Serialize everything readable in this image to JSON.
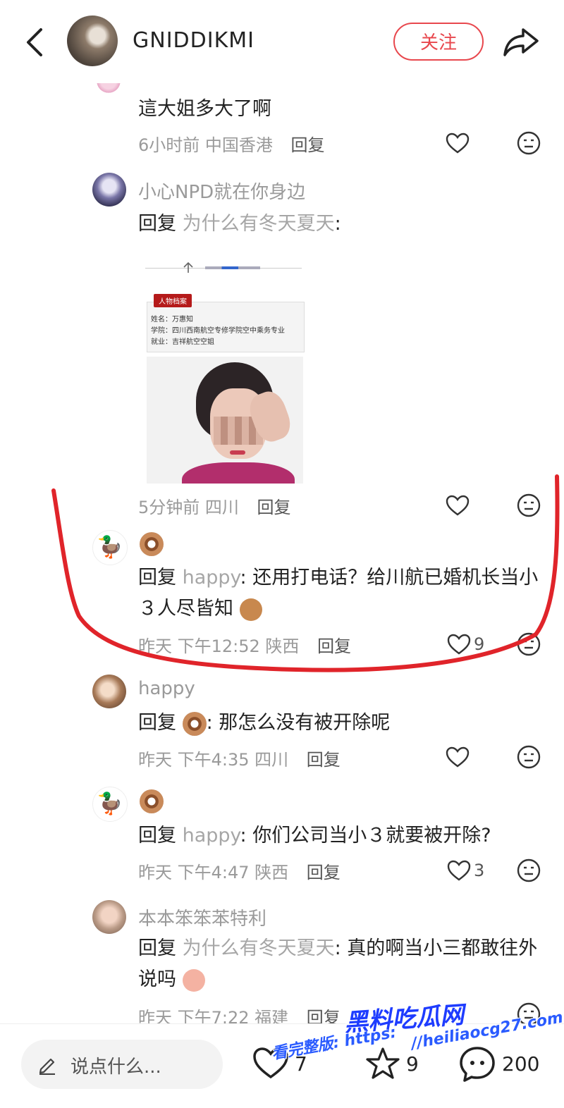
{
  "header": {
    "username": "GNIDDIKMI",
    "follow_label": "关注"
  },
  "comments": [
    {
      "text": "這大姐多大了啊",
      "meta": "6小时前 中国香港",
      "reply_label": "回复"
    },
    {
      "name": "小心NPD就在你身边",
      "reply_prefix": "回复",
      "reply_to": "为什么有冬天夏天",
      "text": ":",
      "meta": "5分钟前 四川",
      "reply_label": "回复",
      "image": {
        "tag": "人物档案",
        "lines": [
          "姓名：万惠知",
          "学院：四川西南航空专修学院空中乘务专业",
          "就业：吉祥航空空姐"
        ]
      }
    },
    {
      "reply_prefix": "回复",
      "reply_to": "happy",
      "text": ": 还用打电话？给川航已婚机长当小３人尽皆知",
      "meta": "昨天 下午12:52 陕西",
      "reply_label": "回复",
      "likes": "9"
    },
    {
      "name": "happy",
      "reply_prefix": "回复",
      "text": ": 那怎么没有被开除呢",
      "meta": "昨天 下午4:35 四川",
      "reply_label": "回复"
    },
    {
      "reply_prefix": "回复",
      "reply_to": "happy",
      "text": ": 你们公司当小３就要被开除?",
      "meta": "昨天 下午4:47 陕西",
      "reply_label": "回复",
      "likes": "3"
    },
    {
      "name": "本本笨笨苯特利",
      "reply_prefix": "回复",
      "reply_to": "为什么有冬天夏天",
      "text": ": 真的啊当小三都敢往外说吗",
      "meta": "昨天 下午7:22 福建",
      "reply_label": "回复"
    }
  ],
  "bottom_bar": {
    "input_placeholder": "说点什么...",
    "likes_count": "7",
    "stars_count": "9",
    "comments_count": "200"
  },
  "watermark": {
    "title": "黑料吃瓜网",
    "prefix": "看完整版: https:",
    "url": "//heiliaocg27.com"
  },
  "colors": {
    "accent_red": "#e8474d",
    "annotation_red": "#e0242a",
    "watermark_blue": "#1e3cff"
  }
}
